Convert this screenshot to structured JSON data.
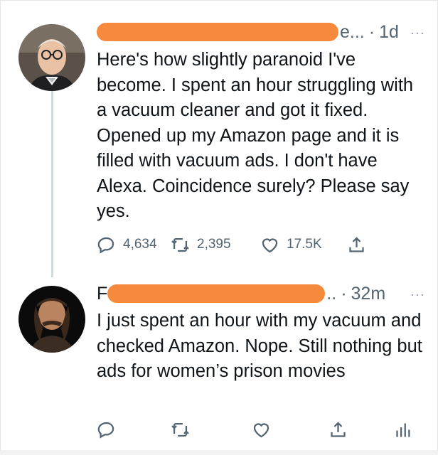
{
  "tweets": [
    {
      "handle_suffix": "e...",
      "separator": "·",
      "time": "1d",
      "more": "···",
      "text": "Here's how slightly paranoid I've become. I spent an hour struggling with a vacuum cleaner and got it fixed. Opened up my Amazon page and it is filled with vacuum ads. I don't have Alexa. Coincidence surely? Please say yes.",
      "replies": "4,634",
      "retweets": "2,395",
      "likes": "17.5K"
    },
    {
      "name_prefix": "F",
      "handle_suffix": "..",
      "separator": "·",
      "time": "32m",
      "more": "···",
      "text": "I just spent an hour with my vacuum and checked Amazon. Nope. Still nothing but ads for women’s prison movies"
    }
  ],
  "colors": {
    "redaction": "#f58a3c",
    "secondary_text": "#536471",
    "thread_line": "#cfd9de"
  },
  "icons": [
    "reply-icon",
    "retweet-icon",
    "like-icon",
    "share-icon",
    "analytics-icon",
    "more-icon"
  ]
}
